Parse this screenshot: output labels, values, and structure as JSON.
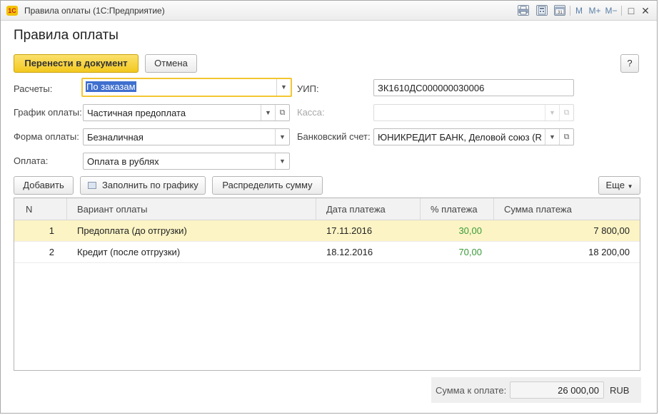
{
  "window": {
    "title": "Правила оплаты  (1С:Предприятие)",
    "logo": "1С",
    "controls": [
      "M",
      "M+",
      "M−",
      "□",
      "✕"
    ]
  },
  "form": {
    "title": "Правила оплаты",
    "primary_button": "Перенести в документ",
    "cancel_button": "Отмена",
    "help_button": "?"
  },
  "fields": {
    "raschety": {
      "label": "Расчеты:",
      "value": "По заказам"
    },
    "grafik": {
      "label": "График оплаты:",
      "value": "Частичная предоплата"
    },
    "forma": {
      "label": "Форма оплаты:",
      "value": "Безналичная"
    },
    "oplata": {
      "label": "Оплата:",
      "value": "Оплата в рублях"
    },
    "uip": {
      "label": "УИП:",
      "value": "ЗК1610ДС000000030006"
    },
    "kassa": {
      "label": "Касса:",
      "value": ""
    },
    "bank": {
      "label": "Банковский счет:",
      "value": "ЮНИКРЕДИТ БАНК, Деловой союз (R"
    }
  },
  "table_toolbar": {
    "add": "Добавить",
    "fill": "Заполнить по графику",
    "distribute": "Распределить сумму",
    "more": "Еще"
  },
  "table": {
    "columns": [
      "N",
      "Вариант оплаты",
      "Дата платежа",
      "% платежа",
      "Сумма платежа"
    ],
    "rows": [
      {
        "n": "1",
        "variant": "Предоплата (до отгрузки)",
        "date": "17.11.2016",
        "pct": "30,00",
        "sum": "7 800,00"
      },
      {
        "n": "2",
        "variant": "Кредит (после отгрузки)",
        "date": "18.12.2016",
        "pct": "70,00",
        "sum": "18 200,00"
      }
    ]
  },
  "footer": {
    "total_label": "Сумма к оплате:",
    "total_value": "26 000,00",
    "currency": "RUB"
  },
  "colors": {
    "primary_button": "#f3c91f",
    "selected_row": "#fcf4c5",
    "percent_text": "#3a9b3a",
    "focus_border": "#f3c632"
  }
}
